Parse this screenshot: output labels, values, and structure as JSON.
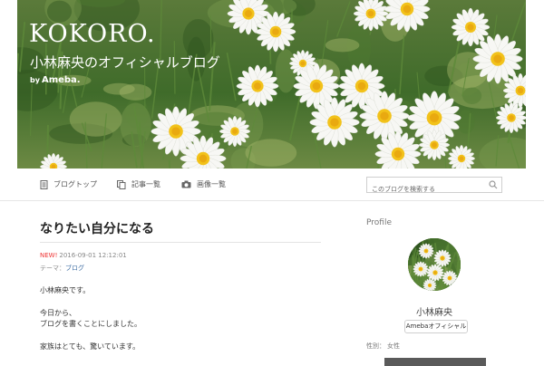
{
  "header": {
    "blog_title": "KOKORO.",
    "subtitle": "小林麻央のオフィシャルブログ",
    "by_text": "by",
    "by_brand": "Ameba."
  },
  "nav": {
    "items": [
      {
        "label": "ブログトップ",
        "icon": "document-icon"
      },
      {
        "label": "記事一覧",
        "icon": "copy-icon"
      },
      {
        "label": "画像一覧",
        "icon": "camera-icon"
      }
    ],
    "search_placeholder": "このブログを検索する"
  },
  "post": {
    "title": "なりたい自分になる",
    "new_label": "NEW!",
    "datetime": "2016-09-01 12:12:01",
    "theme_label": "テーマ：",
    "theme_value": "ブログ",
    "lines": [
      "小林麻央です。",
      "今日から、",
      "ブログを書くことにしました。",
      "家族はとても、驚いています。"
    ]
  },
  "sidebar": {
    "heading": "Profile",
    "name": "小林麻央",
    "badge": "Amebaオフィシャル",
    "gender_label": "性別：",
    "gender_value": "女性"
  },
  "colors": {
    "accent_new": "#ee3333",
    "link": "#3a6aa0",
    "foliage": "#3f6b2a"
  }
}
